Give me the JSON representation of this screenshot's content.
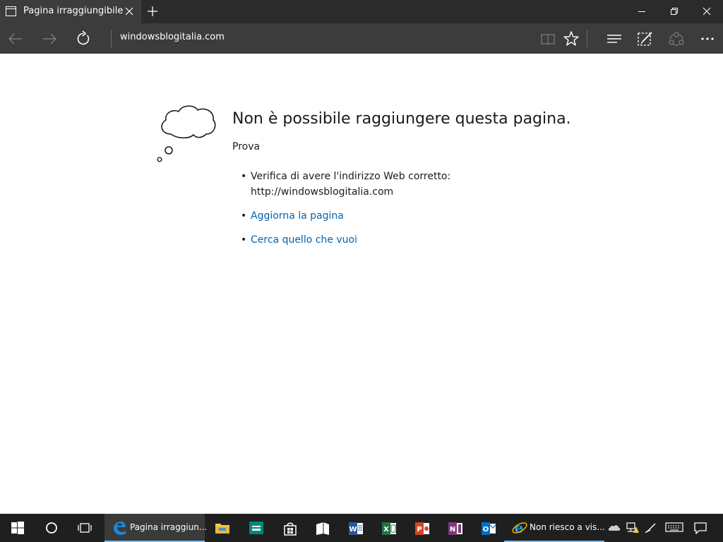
{
  "browser": {
    "tab_title": "Pagina irraggiungibile",
    "address": "windowsblogitalia.com"
  },
  "error_page": {
    "heading": "Non è possibile raggiungere questa pagina.",
    "try_label": "Prova",
    "suggestions": [
      {
        "line1": "Verifica di avere l'indirizzo Web corretto:",
        "line2": "http://windowsblogitalia.com"
      },
      {
        "text": "Aggiorna la pagina"
      },
      {
        "text": "Cerca quello che vuoi"
      }
    ],
    "bullet": "•"
  },
  "taskbar": {
    "apps": [
      {
        "label": "Pagina irraggiun...",
        "icon": "edge-icon",
        "active": true
      },
      {
        "label": "Non riesco a vis...",
        "icon": "internet-explorer-icon",
        "active": false
      }
    ],
    "pinned_icons": [
      "file-explorer-icon",
      "sway-icon",
      "store-icon",
      "mail-icon",
      "word-icon",
      "excel-icon",
      "powerpoint-icon",
      "onenote-icon",
      "outlook-icon"
    ],
    "tray_icons": [
      "onedrive-icon",
      "network-icon",
      "pen-icon",
      "keyboard-icon",
      "action-center-icon"
    ]
  },
  "colors": {
    "titlebar": "#2b2b2b",
    "navbar": "#3c3c3c",
    "link": "#0063b1",
    "taskbar": "#1f1f1f",
    "edge_blue": "#1e88d8"
  }
}
